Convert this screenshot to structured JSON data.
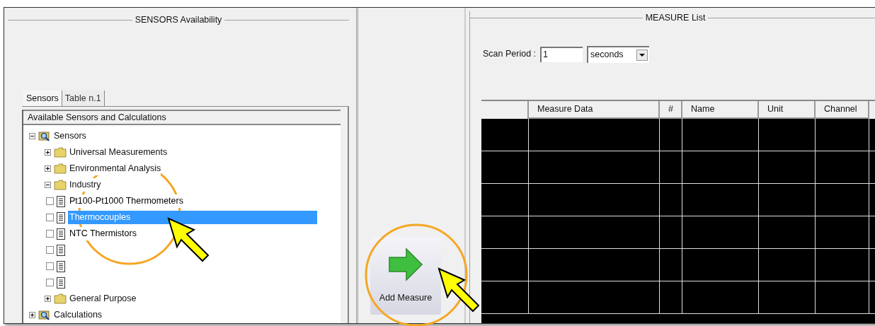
{
  "sensors_panel": {
    "title": "SENSORS Availability",
    "tabs": [
      {
        "label": "Sensors",
        "selected": true
      },
      {
        "label": "Table n.1",
        "selected": false
      }
    ],
    "tree": {
      "header": "Available Sensors and Calculations",
      "items": [
        {
          "kind": "root",
          "label": "Sensors",
          "expanded": true,
          "children": [
            {
              "kind": "folder",
              "label": "Universal Measurements",
              "expanded": false
            },
            {
              "kind": "folder",
              "label": "Environmental Analysis",
              "expanded": false
            },
            {
              "kind": "folder",
              "label": "Industry",
              "expanded": true,
              "children": [
                {
                  "kind": "sensor",
                  "label": "Pt100-Pt1000 Thermometers",
                  "checked": false,
                  "selected": false
                },
                {
                  "kind": "sensor",
                  "label": "Thermocouples",
                  "checked": false,
                  "selected": true
                },
                {
                  "kind": "sensor",
                  "label": "NTC Thermistors",
                  "checked": false,
                  "selected": false
                },
                {
                  "kind": "sensor",
                  "checked": false,
                  "selected": false
                },
                {
                  "kind": "sensor",
                  "checked": false,
                  "selected": false
                },
                {
                  "kind": "sensor",
                  "checked": false,
                  "selected": false
                }
              ]
            },
            {
              "kind": "folder",
              "label": "General Purpose",
              "expanded": false
            }
          ]
        },
        {
          "kind": "root",
          "label": "Calculations",
          "expanded": false
        }
      ]
    }
  },
  "add_button": {
    "label": "Add Measure"
  },
  "measure_panel": {
    "title": "MEASURE List",
    "scan_period": {
      "label": "Scan Period :",
      "value": "1",
      "unit": "seconds"
    },
    "table": {
      "columns": [
        "Measure Data",
        "#",
        "Name",
        "Unit",
        "Channel"
      ]
    }
  }
}
